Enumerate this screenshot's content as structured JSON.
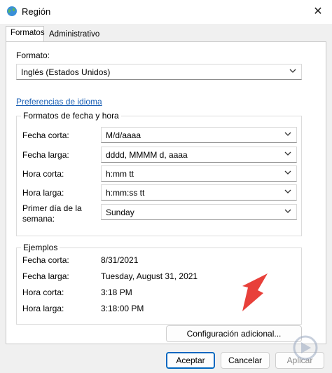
{
  "window": {
    "title": "Región",
    "close_glyph": "✕",
    "icon": "globe-icon"
  },
  "tabs": [
    {
      "label": "Formatos",
      "active": true
    },
    {
      "label": "Administrativo",
      "active": false
    }
  ],
  "format": {
    "label": "Formato:",
    "value": "Inglés (Estados Unidos)"
  },
  "language_link": "Preferencias de idioma",
  "date_time_formats": {
    "group_title": "Formatos de fecha y hora",
    "rows": [
      {
        "label": "Fecha corta:",
        "value": "M/d/aaaa"
      },
      {
        "label": "Fecha larga:",
        "value": "dddd, MMMM d, aaaa"
      },
      {
        "label": "Hora corta:",
        "value": "h:mm tt"
      },
      {
        "label": "Hora larga:",
        "value": "h:mm:ss tt"
      },
      {
        "label_line1": "Primer día de la",
        "label_line2": "semana:",
        "value": "Sunday"
      }
    ]
  },
  "examples": {
    "group_title": "Ejemplos",
    "rows": [
      {
        "label": "Fecha corta:",
        "value": "8/31/2021"
      },
      {
        "label": "Fecha larga:",
        "value": "Tuesday, August 31, 2021"
      },
      {
        "label": "Hora corta:",
        "value": "3:18 PM"
      },
      {
        "label": "Hora larga:",
        "value": "3:18:00 PM"
      }
    ]
  },
  "buttons": {
    "additional": "Configuración adicional...",
    "accept": "Aceptar",
    "cancel": "Cancelar",
    "apply": "Aplicar"
  },
  "colors": {
    "accent": "#0067c0",
    "link": "#1a5fb4",
    "arrow": "#e8403a"
  }
}
